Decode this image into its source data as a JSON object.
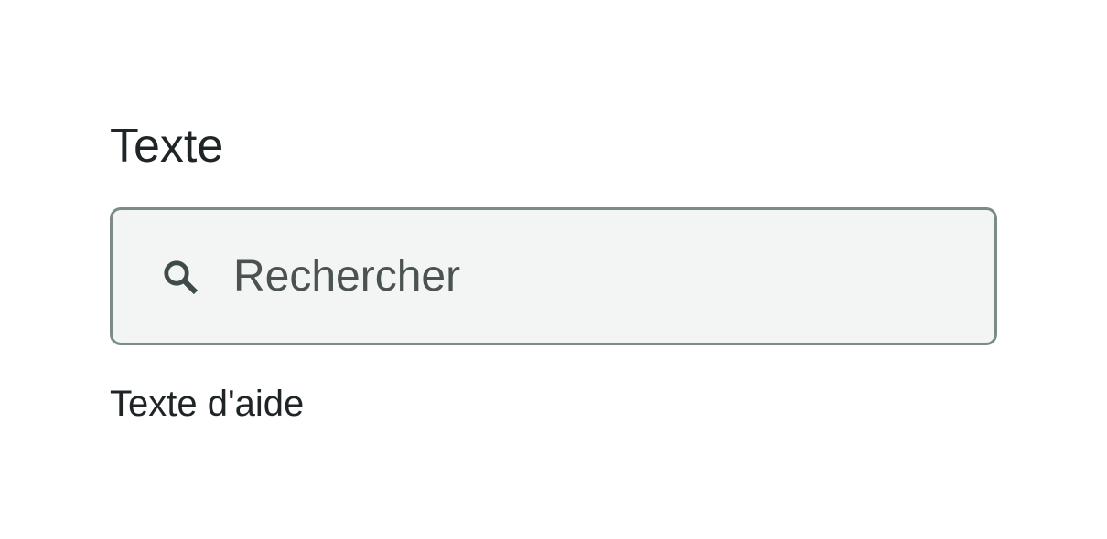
{
  "field": {
    "label": "Texte",
    "placeholder": "Rechercher",
    "value": "",
    "help_text": "Texte d'aide",
    "icon": "search-icon"
  },
  "colors": {
    "label_text": "#1f2526",
    "input_background": "#f3f5f4",
    "input_border": "#7b8b8a",
    "placeholder_text": "#4a5252",
    "icon": "#3f4b4a"
  }
}
